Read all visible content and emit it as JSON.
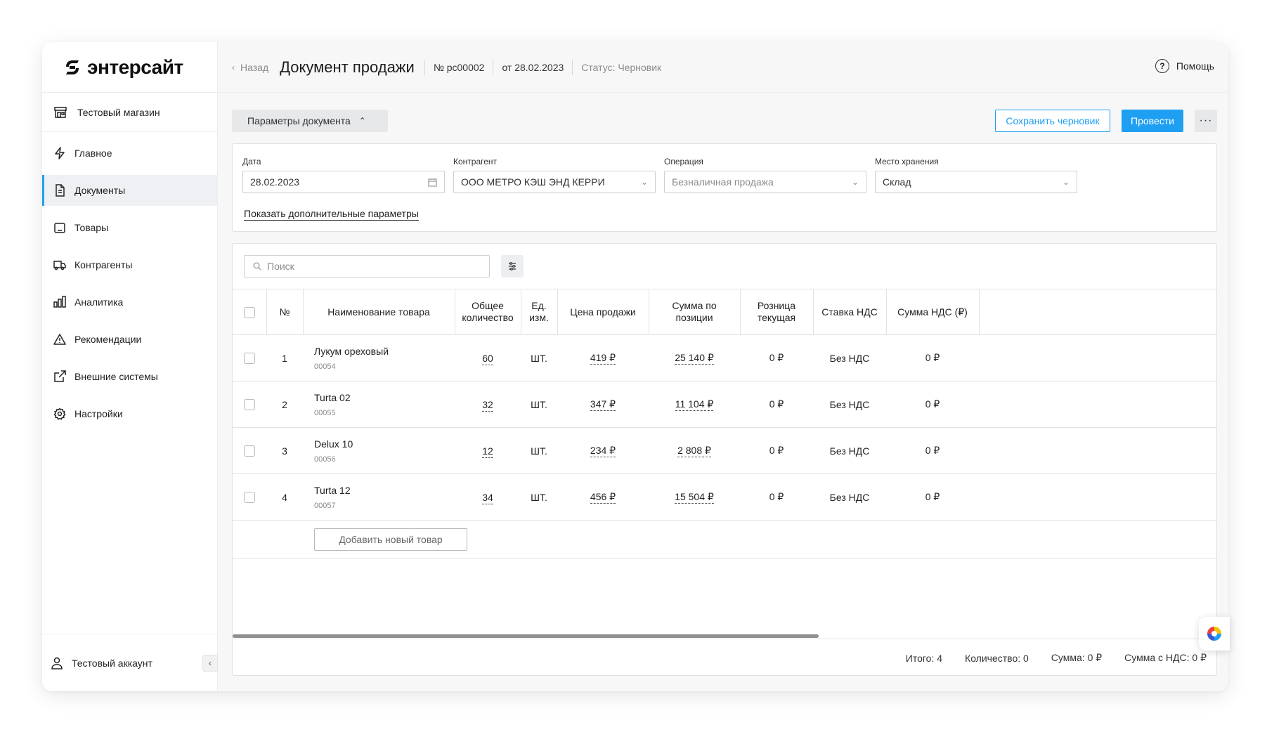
{
  "brand": {
    "name": "энтерсайт"
  },
  "sidebar": {
    "store": "Тестовый магазин",
    "items": [
      {
        "label": "Главное",
        "icon": "lightning-icon"
      },
      {
        "label": "Документы",
        "icon": "document-icon",
        "active": true
      },
      {
        "label": "Товары",
        "icon": "goods-icon"
      },
      {
        "label": "Контрагенты",
        "icon": "truck-icon"
      },
      {
        "label": "Аналитика",
        "icon": "analytics-icon"
      },
      {
        "label": "Рекомендации",
        "icon": "warning-icon"
      },
      {
        "label": "Внешние системы",
        "icon": "external-link-icon"
      },
      {
        "label": "Настройки",
        "icon": "gear-icon"
      }
    ],
    "account": "Тестовый аккаунт"
  },
  "header": {
    "back": "Назад",
    "title": "Документ продажи",
    "number": "№ рс00002",
    "date": "от 28.02.2023",
    "status": "Статус: Черновик",
    "help": "Помощь"
  },
  "toolbar": {
    "params": "Параметры документа",
    "save": "Сохранить черновик",
    "post": "Провести",
    "more": "···"
  },
  "params": {
    "date": {
      "label": "Дата",
      "value": "28.02.2023"
    },
    "counterparty": {
      "label": "Контрагент",
      "value": "ООО МЕТРО КЭШ ЭНД КЕРРИ"
    },
    "operation": {
      "label": "Операция",
      "value": "Безналичная продажа"
    },
    "storage": {
      "label": "Место хранения",
      "value": "Склад"
    },
    "more_link": "Показать дополнительные параметры"
  },
  "search": {
    "placeholder": "Поиск"
  },
  "table": {
    "headers": {
      "num": "№",
      "name": "Наименование товара",
      "qty": "Общее количество",
      "unit": "Ед. изм.",
      "price": "Цена продажи",
      "sum": "Сумма по позиции",
      "retail": "Розница текущая",
      "vat_rate": "Ставка НДС",
      "vat_sum": "Сумма НДС (₽)"
    },
    "rows": [
      {
        "num": "1",
        "name": "Лукум ореховый",
        "code": "00054",
        "qty": "60",
        "unit": "ШТ.",
        "price": "419 ₽",
        "sum": "25 140 ₽",
        "retail": "0 ₽",
        "vat_rate": "Без НДС",
        "vat_sum": "0 ₽"
      },
      {
        "num": "2",
        "name": "Turta 02",
        "code": "00055",
        "qty": "32",
        "unit": "ШТ.",
        "price": "347 ₽",
        "sum": "11 104 ₽",
        "retail": "0 ₽",
        "vat_rate": "Без НДС",
        "vat_sum": "0 ₽"
      },
      {
        "num": "3",
        "name": "Delux 10",
        "code": "00056",
        "qty": "12",
        "unit": "ШТ.",
        "price": "234 ₽",
        "sum": "2 808 ₽",
        "retail": "0 ₽",
        "vat_rate": "Без НДС",
        "vat_sum": "0 ₽"
      },
      {
        "num": "4",
        "name": "Turta 12",
        "code": "00057",
        "qty": "34",
        "unit": "ШТ.",
        "price": "456 ₽",
        "sum": "15 504 ₽",
        "retail": "0 ₽",
        "vat_rate": "Без НДС",
        "vat_sum": "0 ₽"
      }
    ],
    "add_button": "Добавить новый товар"
  },
  "footer": {
    "total": "Итого: 4",
    "quantity": "Количество: 0",
    "sum": "Сумма: 0 ₽",
    "sum_vat": "Сумма с НДС: 0 ₽"
  },
  "colors": {
    "accent": "#1e9ff2",
    "active_bg": "#eef0f3"
  }
}
